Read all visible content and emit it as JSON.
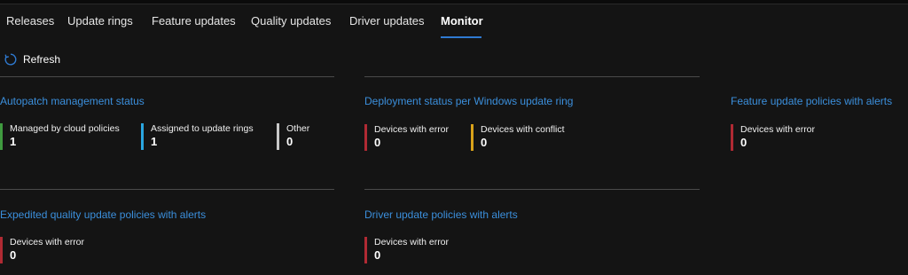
{
  "tabs": [
    {
      "label": "Releases"
    },
    {
      "label": "Update rings"
    },
    {
      "label": "Feature updates"
    },
    {
      "label": "Quality updates"
    },
    {
      "label": "Driver updates"
    },
    {
      "label": "Monitor",
      "active": true
    }
  ],
  "toolbar": {
    "refresh_label": "Refresh",
    "refresh_icon": "refresh-icon"
  },
  "colors": {
    "accent": "#2f7ad1",
    "title_blue": "#3b8fdc",
    "green": "#3f9a3f",
    "cyan": "#2aa6e0",
    "gray": "#c8c8c8",
    "red": "#b02a33",
    "amber": "#d9a21a"
  },
  "cards": {
    "autopatch": {
      "title": "Autopatch management status",
      "metrics": [
        {
          "label": "Managed by cloud policies",
          "value": "1"
        },
        {
          "label": "Assigned to update rings",
          "value": "1"
        },
        {
          "label": "Other",
          "value": "0"
        }
      ]
    },
    "deployment": {
      "title": "Deployment status per Windows update ring",
      "metrics": [
        {
          "label": "Devices with error",
          "value": "0"
        },
        {
          "label": "Devices with conflict",
          "value": "0"
        }
      ]
    },
    "feature": {
      "title": "Feature update policies with alerts",
      "metrics": [
        {
          "label": "Devices with error",
          "value": "0"
        }
      ]
    },
    "expedited": {
      "title": "Expedited quality update policies with alerts",
      "metrics": [
        {
          "label": "Devices with error",
          "value": "0"
        }
      ]
    },
    "driver": {
      "title": "Driver update policies with alerts",
      "metrics": [
        {
          "label": "Devices with error",
          "value": "0"
        }
      ]
    }
  }
}
